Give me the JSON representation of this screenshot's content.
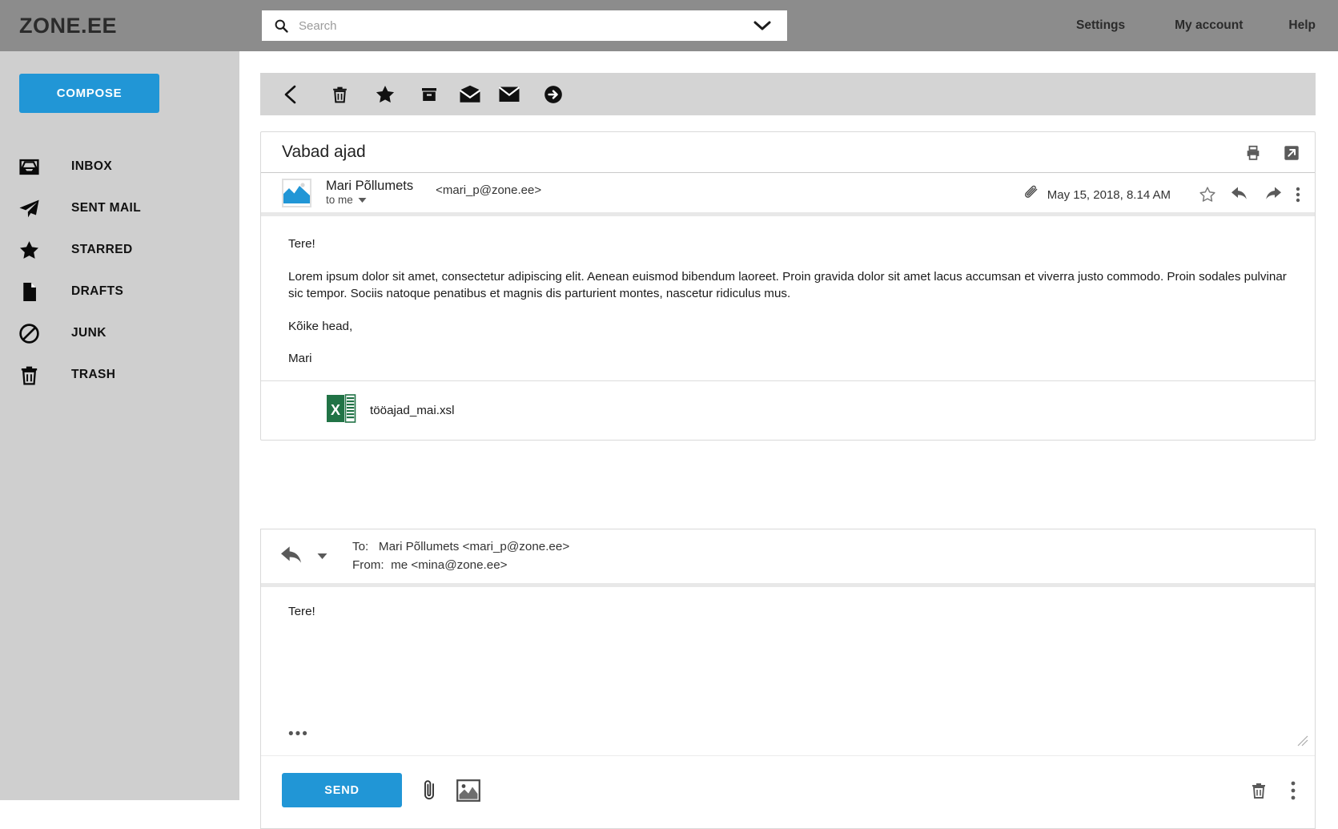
{
  "header": {
    "brand": "ZONE.EE",
    "search": {
      "placeholder": "Search",
      "value": "",
      "icon": "search-icon",
      "caret_icon": "chevron-down-icon"
    },
    "nav": {
      "settings": "Settings",
      "my_account": "My account",
      "help": "Help"
    }
  },
  "sidebar": {
    "compose_label": "COMPOSE",
    "items": [
      {
        "label": "INBOX",
        "icon": "inbox-icon"
      },
      {
        "label": "SENT MAIL",
        "icon": "paper-plane-icon"
      },
      {
        "label": "STARRED",
        "icon": "star-icon"
      },
      {
        "label": "DRAFTS",
        "icon": "document-icon"
      },
      {
        "label": "JUNK",
        "icon": "block-icon"
      },
      {
        "label": "TRASH",
        "icon": "trash-icon"
      }
    ]
  },
  "toolbar": {
    "buttons": [
      {
        "name": "back-button",
        "icon": "chevron-left-icon"
      },
      {
        "name": "delete-button",
        "icon": "trash-icon"
      },
      {
        "name": "star-button",
        "icon": "star-icon"
      },
      {
        "name": "archive-button",
        "icon": "archive-box-icon"
      },
      {
        "name": "mark-read-button",
        "icon": "envelope-open-icon"
      },
      {
        "name": "mark-unread-button",
        "icon": "envelope-closed-icon"
      },
      {
        "name": "move-to-button",
        "icon": "arrow-right-circle-icon"
      }
    ]
  },
  "message": {
    "subject": "Vabad ajad",
    "print_icon": "print-icon",
    "popout_icon": "open-in-new-icon",
    "sender_name": "Mari Põllumets",
    "sender_email": "<mari_p@zone.ee>",
    "recipient_line": "to me",
    "recipient_caret": "caret-down-icon",
    "avatar_icon": "image-placeholder-icon",
    "attachment_indicator_icon": "paperclip-icon",
    "date": "May 15, 2018, 8.14 AM",
    "actions": [
      {
        "name": "star-message-button",
        "icon": "star-outline-icon"
      },
      {
        "name": "reply-message-button",
        "icon": "reply-arrow-icon"
      },
      {
        "name": "forward-message-button",
        "icon": "forward-arrow-icon"
      },
      {
        "name": "more-options-button",
        "icon": "kebab-menu-icon"
      }
    ],
    "body": [
      "Tere!",
      "Lorem ipsum dolor sit amet, consectetur adipiscing elit. Aenean euismod bibendum laoreet. Proin gravida dolor sit amet lacus accumsan et viverra justo commodo. Proin sodales pulvinar sic tempor. Sociis natoque penatibus et magnis dis parturient montes, nascetur ridiculus mus.",
      "Kõike head,",
      "Mari"
    ],
    "attachment": {
      "name": "tööajad_mai.xsl",
      "type_icon": "excel-file-icon",
      "type_letter": "X"
    }
  },
  "reply": {
    "mode_icon": "reply-arrow-icon",
    "mode_caret": "caret-down-icon",
    "to_label": "To:",
    "to_value": "Mari Põllumets <mari_p@zone.ee>",
    "from_label": "From:",
    "from_value": "me <mina@zone.ee>",
    "to_line": "To:   Mari Põllumets <mari_p@zone.ee>",
    "from_line": "From:  me <mina@zone.ee>",
    "body_value": "Tere!",
    "more_dots": "•••",
    "send_label": "SEND",
    "attach_icon": "paperclip-icon",
    "image_icon": "insert-image-icon",
    "discard_icon": "trash-icon",
    "more_icon": "kebab-menu-icon",
    "resize_icon": "resize-handle-icon"
  },
  "colors": {
    "topbar": "#8c8c8c",
    "sidebar": "#cfcfcf",
    "accent_blue": "#2196d6",
    "toolbar_gray": "#d4d4d4",
    "excel_green": "#217346"
  }
}
